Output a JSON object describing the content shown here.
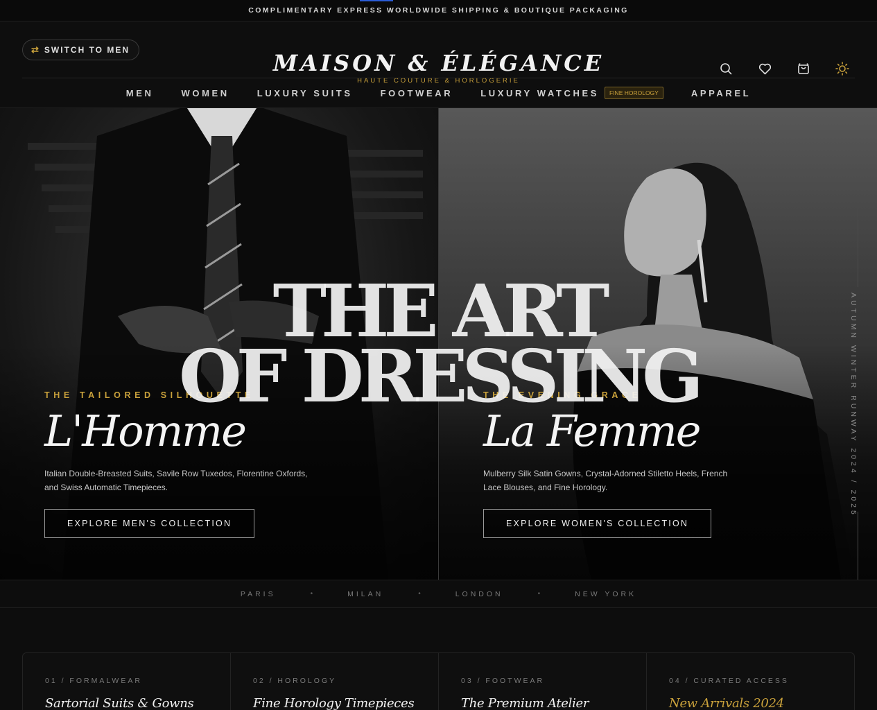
{
  "announcement": {
    "text": "COMPLIMENTARY EXPRESS WORLDWIDE SHIPPING & BOUTIQUE PACKAGING"
  },
  "header": {
    "switch_label": "SWITCH TO MEN",
    "switch_icon": "swap-arrows-icon",
    "brand_name": "MAISON & ÉLÉGANCE",
    "brand_sub": "HAUTE COUTURE & HORLOGERIE",
    "icons": [
      "search-icon",
      "heart-icon",
      "bag-icon",
      "sun-icon"
    ]
  },
  "nav": {
    "items": [
      {
        "label": "MEN"
      },
      {
        "label": "WOMEN"
      },
      {
        "label": "LUXURY SUITS"
      },
      {
        "label": "FOOTWEAR"
      },
      {
        "label": "LUXURY WATCHES",
        "badge": "FINE HOROLOGY"
      },
      {
        "label": "APPAREL"
      }
    ]
  },
  "hero": {
    "title_line1": "THE ART",
    "title_line2": "OF DRESSING",
    "men": {
      "eyebrow": "THE TAILORED SILHOUETTE",
      "title": "L'Homme",
      "description": "Italian Double-Breasted Suits, Savile Row Tuxedos, Florentine Oxfords, and Swiss Automatic Timepieces.",
      "cta": "EXPLORE MEN'S COLLECTION"
    },
    "women": {
      "eyebrow": "THE EVENING GRACE",
      "title": "La Femme",
      "description": "Mulberry Silk Satin Gowns, Crystal-Adorned Stiletto Heels, French Lace Blouses, and Fine Horology.",
      "cta": "EXPLORE WOMEN'S COLLECTION"
    },
    "vertical_text": "AUTUMN WINTER RUNWAY 2024 / 2025"
  },
  "cities": [
    "PARIS",
    "MILAN",
    "LONDON",
    "NEW YORK"
  ],
  "cards": [
    {
      "num": "01 / FORMALWEAR",
      "title": "Sartorial Suits & Gowns"
    },
    {
      "num": "02 / HOROLOGY",
      "title": "Fine Horology Timepieces"
    },
    {
      "num": "03 / FOOTWEAR",
      "title": "The Premium Atelier"
    },
    {
      "num": "04 / CURATED ACCESS",
      "title": "New Arrivals 2024"
    }
  ],
  "colors": {
    "accent_gold": "#c9a13b",
    "background": "#0d0d0d"
  }
}
